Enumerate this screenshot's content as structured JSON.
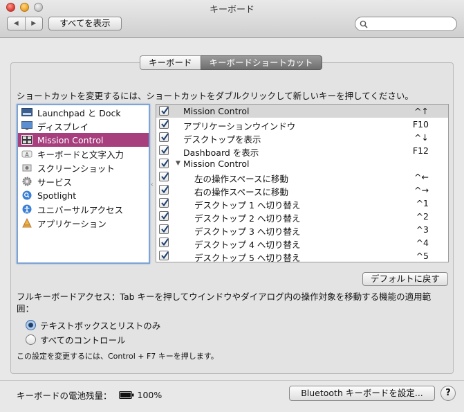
{
  "window": {
    "title": "キーボード",
    "show_all": "すべてを表示",
    "search_placeholder": ""
  },
  "tabs": [
    {
      "label": "キーボード",
      "active": false
    },
    {
      "label": "キーボードショートカット",
      "active": true
    }
  ],
  "instruction": "ショートカットを変更するには、ショートカットをダブルクリックして新しいキーを押してください。",
  "categories": [
    {
      "label": "Launchpad と Dock",
      "icon": "launchpad-dock-icon"
    },
    {
      "label": "ディスプレイ",
      "icon": "display-icon"
    },
    {
      "label": "Mission Control",
      "icon": "mission-control-icon",
      "selected": true
    },
    {
      "label": "キーボードと文字入力",
      "icon": "keyboard-text-icon"
    },
    {
      "label": "スクリーンショット",
      "icon": "screenshot-icon"
    },
    {
      "label": "サービス",
      "icon": "services-gear-icon"
    },
    {
      "label": "Spotlight",
      "icon": "spotlight-icon"
    },
    {
      "label": "ユニバーサルアクセス",
      "icon": "universal-access-icon"
    },
    {
      "label": "アプリケーション",
      "icon": "applications-icon"
    }
  ],
  "shortcuts": [
    {
      "label": "Mission Control",
      "key": "^↑",
      "checked": true,
      "indent": 0
    },
    {
      "label": "アプリケーションウインドウ",
      "key": "F10",
      "checked": true,
      "indent": 0
    },
    {
      "label": "デスクトップを表示",
      "key": "^↓",
      "checked": true,
      "indent": 0
    },
    {
      "label": "Dashboard を表示",
      "key": "F12",
      "checked": true,
      "indent": 0
    },
    {
      "label": "Mission Control",
      "key": "",
      "checked": true,
      "indent": 0,
      "group": true
    },
    {
      "label": "左の操作スペースに移動",
      "key": "^←",
      "checked": true,
      "indent": 1
    },
    {
      "label": "右の操作スペースに移動",
      "key": "^→",
      "checked": true,
      "indent": 1
    },
    {
      "label": "デスクトップ 1 へ切り替え",
      "key": "^1",
      "checked": true,
      "indent": 1
    },
    {
      "label": "デスクトップ 2 へ切り替え",
      "key": "^2",
      "checked": true,
      "indent": 1
    },
    {
      "label": "デスクトップ 3 へ切り替え",
      "key": "^3",
      "checked": true,
      "indent": 1
    },
    {
      "label": "デスクトップ 4 へ切り替え",
      "key": "^4",
      "checked": true,
      "indent": 1
    },
    {
      "label": "デスクトップ 5 へ切り替え",
      "key": "^5",
      "checked": true,
      "indent": 1
    }
  ],
  "defaults_button": "デフォルトに戻す",
  "full_keyboard_access": {
    "text": "フルキーボードアクセス：Tab キーを押してウインドウやダイアログ内の操作対象を移動する機能の適用範囲：",
    "options": [
      {
        "label": "テキストボックスとリストのみ",
        "selected": true
      },
      {
        "label": "すべてのコントロール",
        "selected": false
      }
    ],
    "note": "この設定を変更するには、Control + F7 キーを押します。"
  },
  "battery": {
    "label": "キーボードの電池残量：",
    "value": "100%"
  },
  "bluetooth_button": "Bluetooth キーボードを設定...",
  "help_label": "?",
  "colors": {
    "selection": "#a73f7f",
    "focus_ring": "#7ea3d4",
    "checkbox_check": "#1b3c6b"
  }
}
